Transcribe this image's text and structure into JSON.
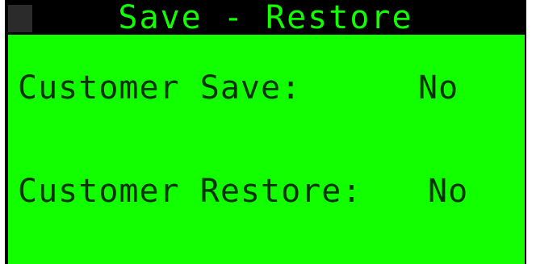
{
  "title": "Save - Restore",
  "items": [
    {
      "label": "Customer Save:",
      "value": "No"
    },
    {
      "label": "Customer Restore:",
      "value": "No"
    }
  ],
  "colors": {
    "screen_background": "#12ff00",
    "title_bar": "#000000",
    "title_text": "#12ff00",
    "text": "#003300"
  }
}
